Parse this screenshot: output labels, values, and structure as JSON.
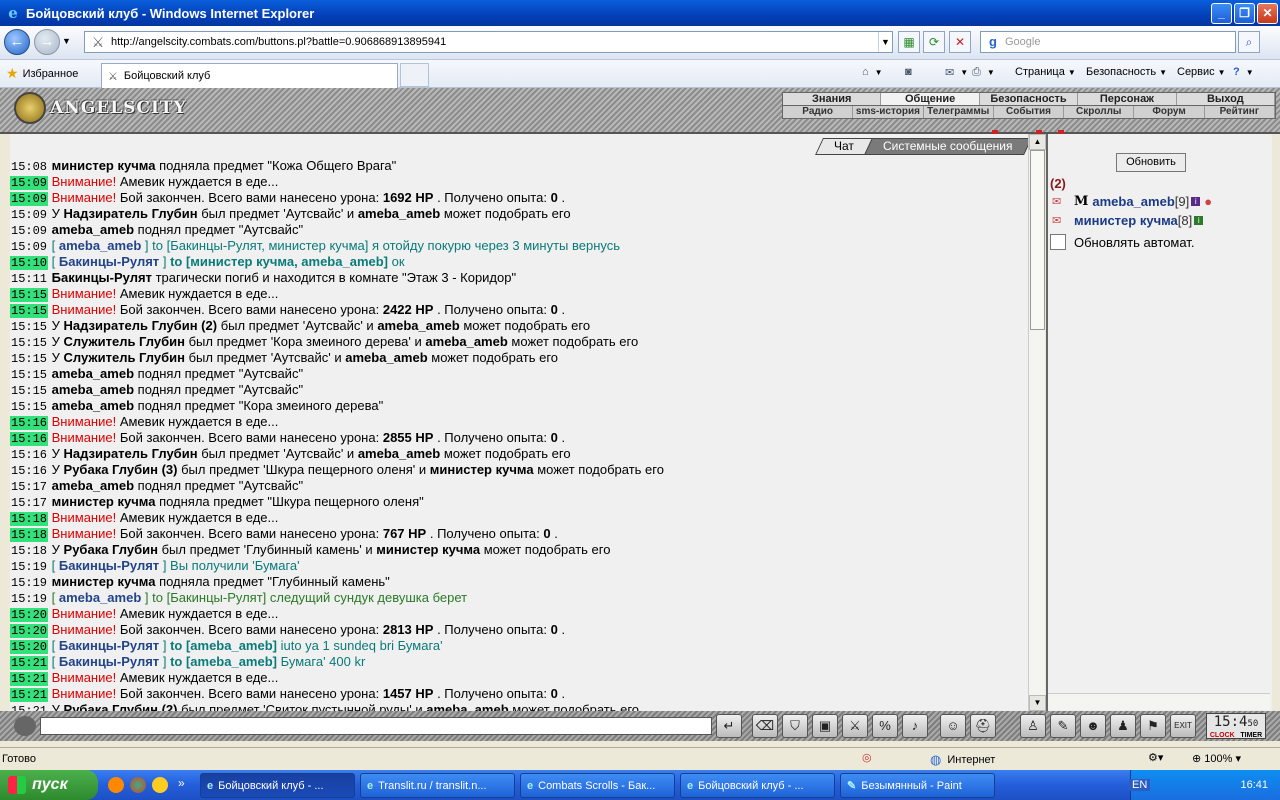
{
  "window": {
    "title": "Бойцовский клуб - Windows Internet Explorer"
  },
  "browser": {
    "url": "http://angelscity.combats.com/buttons.pl?battle=0.906868913895941",
    "search_placeholder": "Google",
    "favorites_label": "Избранное",
    "tab_title": "Бойцовский клуб",
    "cmd_page": "Страница",
    "cmd_security": "Безопасность",
    "cmd_service": "Сервис"
  },
  "game": {
    "logo": "ANGELSCITY",
    "menu_top": [
      "Знания",
      "Общение",
      "Безопасность",
      "Персонаж",
      "Выход"
    ],
    "menu_bottom": [
      "Радио",
      "sms-история",
      "Телеграммы",
      "События",
      "Скроллы",
      "Форум",
      "Рейтинг"
    ],
    "tab_chat": "Чат",
    "tab_system": "Системные сообщения"
  },
  "chat": [
    {
      "t": "15:08",
      "hl": false,
      "parts": [
        [
          "b",
          "министер кучма"
        ],
        [
          "",
          "подняла предмет \"Кожа Общего Врага\""
        ]
      ]
    },
    {
      "t": "15:09",
      "hl": true,
      "parts": [
        [
          "warn",
          "Внимание!"
        ],
        [
          "",
          "Амевик нуждается в еде..."
        ]
      ]
    },
    {
      "t": "15:09",
      "hl": true,
      "parts": [
        [
          "warn",
          "Внимание!"
        ],
        [
          "",
          "Бой закончен. Всего вами нанесено урона:"
        ],
        [
          "b",
          "1692 HP"
        ],
        [
          "",
          ". Получено опыта:"
        ],
        [
          "b",
          "0"
        ],
        [
          "",
          "."
        ]
      ]
    },
    {
      "t": "15:09",
      "hl": false,
      "parts": [
        [
          "",
          "У"
        ],
        [
          "b",
          "Надзиратель Глубин"
        ],
        [
          "",
          "был предмет 'Аутсвайс' и"
        ],
        [
          "b",
          "ameba_ameb"
        ],
        [
          "",
          "может подобрать его"
        ]
      ]
    },
    {
      "t": "15:09",
      "hl": false,
      "parts": [
        [
          "b",
          "ameba_ameb"
        ],
        [
          "",
          "поднял предмет \"Аутсвайс\""
        ]
      ]
    },
    {
      "t": "15:09",
      "hl": false,
      "parts": [
        [
          "pm",
          "["
        ],
        [
          "nm",
          "ameba_ameb"
        ],
        [
          "pm",
          "] to [Бакинцы-Рулят, министер кучма] я отойду покурю через 3 минуты вернусь"
        ]
      ]
    },
    {
      "t": "15:10",
      "hl": true,
      "parts": [
        [
          "pm",
          "["
        ],
        [
          "nm",
          "Бакинцы-Рулят"
        ],
        [
          "pm",
          "]"
        ],
        [
          "pmb",
          "to [министер кучма, ameba_ameb]"
        ],
        [
          "pm",
          "ок"
        ]
      ]
    },
    {
      "t": "15:11",
      "hl": false,
      "parts": [
        [
          "b",
          "Бакинцы-Рулят"
        ],
        [
          "",
          "трагически погиб и находится в комнате \"Этаж 3 - Коридор\""
        ]
      ]
    },
    {
      "t": "15:15",
      "hl": true,
      "parts": [
        [
          "warn",
          "Внимание!"
        ],
        [
          "",
          "Амевик нуждается в еде..."
        ]
      ]
    },
    {
      "t": "15:15",
      "hl": true,
      "parts": [
        [
          "warn",
          "Внимание!"
        ],
        [
          "",
          "Бой закончен. Всего вами нанесено урона:"
        ],
        [
          "b",
          "2422 HP"
        ],
        [
          "",
          ". Получено опыта:"
        ],
        [
          "b",
          "0"
        ],
        [
          "",
          "."
        ]
      ]
    },
    {
      "t": "15:15",
      "hl": false,
      "parts": [
        [
          "",
          "У"
        ],
        [
          "b",
          "Надзиратель Глубин (2)"
        ],
        [
          "",
          "был предмет 'Аутсвайс' и"
        ],
        [
          "b",
          "ameba_ameb"
        ],
        [
          "",
          "может подобрать его"
        ]
      ]
    },
    {
      "t": "15:15",
      "hl": false,
      "parts": [
        [
          "",
          "У"
        ],
        [
          "b",
          "Служитель Глубин"
        ],
        [
          "",
          "был предмет 'Кора змеиного дерева' и"
        ],
        [
          "b",
          "ameba_ameb"
        ],
        [
          "",
          "может подобрать его"
        ]
      ]
    },
    {
      "t": "15:15",
      "hl": false,
      "parts": [
        [
          "",
          "У"
        ],
        [
          "b",
          "Служитель Глубин"
        ],
        [
          "",
          "был предмет 'Аутсвайс' и"
        ],
        [
          "b",
          "ameba_ameb"
        ],
        [
          "",
          "может подобрать его"
        ]
      ]
    },
    {
      "t": "15:15",
      "hl": false,
      "parts": [
        [
          "b",
          "ameba_ameb"
        ],
        [
          "",
          "поднял предмет \"Аутсвайс\""
        ]
      ]
    },
    {
      "t": "15:15",
      "hl": false,
      "parts": [
        [
          "b",
          "ameba_ameb"
        ],
        [
          "",
          "поднял предмет \"Аутсвайс\""
        ]
      ]
    },
    {
      "t": "15:15",
      "hl": false,
      "parts": [
        [
          "b",
          "ameba_ameb"
        ],
        [
          "",
          "поднял предмет \"Кора змеиного дерева\""
        ]
      ]
    },
    {
      "t": "15:16",
      "hl": true,
      "parts": [
        [
          "warn",
          "Внимание!"
        ],
        [
          "",
          "Амевик нуждается в еде..."
        ]
      ]
    },
    {
      "t": "15:16",
      "hl": true,
      "parts": [
        [
          "warn",
          "Внимание!"
        ],
        [
          "",
          "Бой закончен. Всего вами нанесено урона:"
        ],
        [
          "b",
          "2855 HP"
        ],
        [
          "",
          ". Получено опыта:"
        ],
        [
          "b",
          "0"
        ],
        [
          "",
          "."
        ]
      ]
    },
    {
      "t": "15:16",
      "hl": false,
      "parts": [
        [
          "",
          "У"
        ],
        [
          "b",
          "Надзиратель Глубин"
        ],
        [
          "",
          "был предмет 'Аутсвайс' и"
        ],
        [
          "b",
          "ameba_ameb"
        ],
        [
          "",
          "может подобрать его"
        ]
      ]
    },
    {
      "t": "15:16",
      "hl": false,
      "parts": [
        [
          "",
          "У"
        ],
        [
          "b",
          "Рубака Глубин (3)"
        ],
        [
          "",
          "был предмет 'Шкура пещерного оленя' и"
        ],
        [
          "b",
          "министер кучма"
        ],
        [
          "",
          "может подобрать его"
        ]
      ]
    },
    {
      "t": "15:17",
      "hl": false,
      "parts": [
        [
          "b",
          "ameba_ameb"
        ],
        [
          "",
          "поднял предмет \"Аутсвайс\""
        ]
      ]
    },
    {
      "t": "15:17",
      "hl": false,
      "parts": [
        [
          "b",
          "министер кучма"
        ],
        [
          "",
          "подняла предмет \"Шкура пещерного оленя\""
        ]
      ]
    },
    {
      "t": "15:18",
      "hl": true,
      "parts": [
        [
          "warn",
          "Внимание!"
        ],
        [
          "",
          "Амевик нуждается в еде..."
        ]
      ]
    },
    {
      "t": "15:18",
      "hl": true,
      "parts": [
        [
          "warn",
          "Внимание!"
        ],
        [
          "",
          "Бой закончен. Всего вами нанесено урона:"
        ],
        [
          "b",
          "767 HP"
        ],
        [
          "",
          ". Получено опыта:"
        ],
        [
          "b",
          "0"
        ],
        [
          "",
          "."
        ]
      ]
    },
    {
      "t": "15:18",
      "hl": false,
      "parts": [
        [
          "",
          "У"
        ],
        [
          "b",
          "Рубака Глубин"
        ],
        [
          "",
          "был предмет 'Глубинный камень' и"
        ],
        [
          "b",
          "министер кучма"
        ],
        [
          "",
          "может подобрать его"
        ]
      ]
    },
    {
      "t": "15:19",
      "hl": false,
      "parts": [
        [
          "pm",
          "["
        ],
        [
          "nm",
          "Бакинцы-Рулят"
        ],
        [
          "pm",
          "] Вы получили 'Бумага'"
        ]
      ]
    },
    {
      "t": "15:19",
      "hl": false,
      "parts": [
        [
          "b",
          "министер кучма"
        ],
        [
          "",
          "подняла предмет \"Глубинный камень\""
        ]
      ]
    },
    {
      "t": "15:19",
      "hl": false,
      "parts": [
        [
          "pmg",
          "["
        ],
        [
          "nm",
          "ameba_ameb"
        ],
        [
          "pmg",
          "] to [Бакинцы-Рулят] следущий сундук девушка берет"
        ]
      ]
    },
    {
      "t": "15:20",
      "hl": true,
      "parts": [
        [
          "warn",
          "Внимание!"
        ],
        [
          "",
          "Амевик нуждается в еде..."
        ]
      ]
    },
    {
      "t": "15:20",
      "hl": true,
      "parts": [
        [
          "warn",
          "Внимание!"
        ],
        [
          "",
          "Бой закончен. Всего вами нанесено урона:"
        ],
        [
          "b",
          "2813 HP"
        ],
        [
          "",
          ". Получено опыта:"
        ],
        [
          "b",
          "0"
        ],
        [
          "",
          "."
        ]
      ]
    },
    {
      "t": "15:20",
      "hl": true,
      "parts": [
        [
          "pm",
          "["
        ],
        [
          "nm",
          "Бакинцы-Рулят"
        ],
        [
          "pm",
          "]"
        ],
        [
          "pmb",
          "to [ameba_ameb]"
        ],
        [
          "pm",
          "iuto ya 1 sundeq bri Бумага'"
        ]
      ]
    },
    {
      "t": "15:21",
      "hl": true,
      "parts": [
        [
          "pm",
          "["
        ],
        [
          "nm",
          "Бакинцы-Рулят"
        ],
        [
          "pm",
          "]"
        ],
        [
          "pmb",
          "to [ameba_ameb]"
        ],
        [
          "pm",
          "Бумага' 400 kr"
        ]
      ]
    },
    {
      "t": "15:21",
      "hl": true,
      "parts": [
        [
          "warn",
          "Внимание!"
        ],
        [
          "",
          "Амевик нуждается в еде..."
        ]
      ]
    },
    {
      "t": "15:21",
      "hl": true,
      "parts": [
        [
          "warn",
          "Внимание!"
        ],
        [
          "",
          "Бой закончен. Всего вами нанесено урона:"
        ],
        [
          "b",
          "1457 HP"
        ],
        [
          "",
          ". Получено опыта:"
        ],
        [
          "b",
          "0"
        ],
        [
          "",
          "."
        ]
      ]
    },
    {
      "t": "15:21",
      "hl": false,
      "parts": [
        [
          "",
          "У"
        ],
        [
          "b",
          "Рубака Глубин (2)"
        ],
        [
          "",
          "был предмет 'Свиток пустынной руды' и"
        ],
        [
          "b",
          "ameba_ameb"
        ],
        [
          "",
          "может подобрать его"
        ]
      ]
    }
  ],
  "right": {
    "refresh": "Обновить",
    "count": "(2)",
    "users": [
      {
        "name": "ameba_ameb",
        "level": "[9]"
      },
      {
        "name": "министер кучма",
        "level": "[8]"
      }
    ],
    "auto": "Обновлять автомат."
  },
  "clock": {
    "time": "15:4",
    "sec": "50",
    "l1": "CLOCK",
    "l2": "TIMER"
  },
  "status": {
    "text": "Готово",
    "zone": "Интернет",
    "zoom": "100%"
  },
  "taskbar": {
    "start": "пуск",
    "tasks": [
      "Бойцовский клуб - ...",
      "Translit.ru / translit.n...",
      "Combats Scrolls - Бак...",
      "Бойцовский клуб - ...",
      "Безымянный - Paint"
    ],
    "lang": "EN",
    "time": "16:41"
  }
}
